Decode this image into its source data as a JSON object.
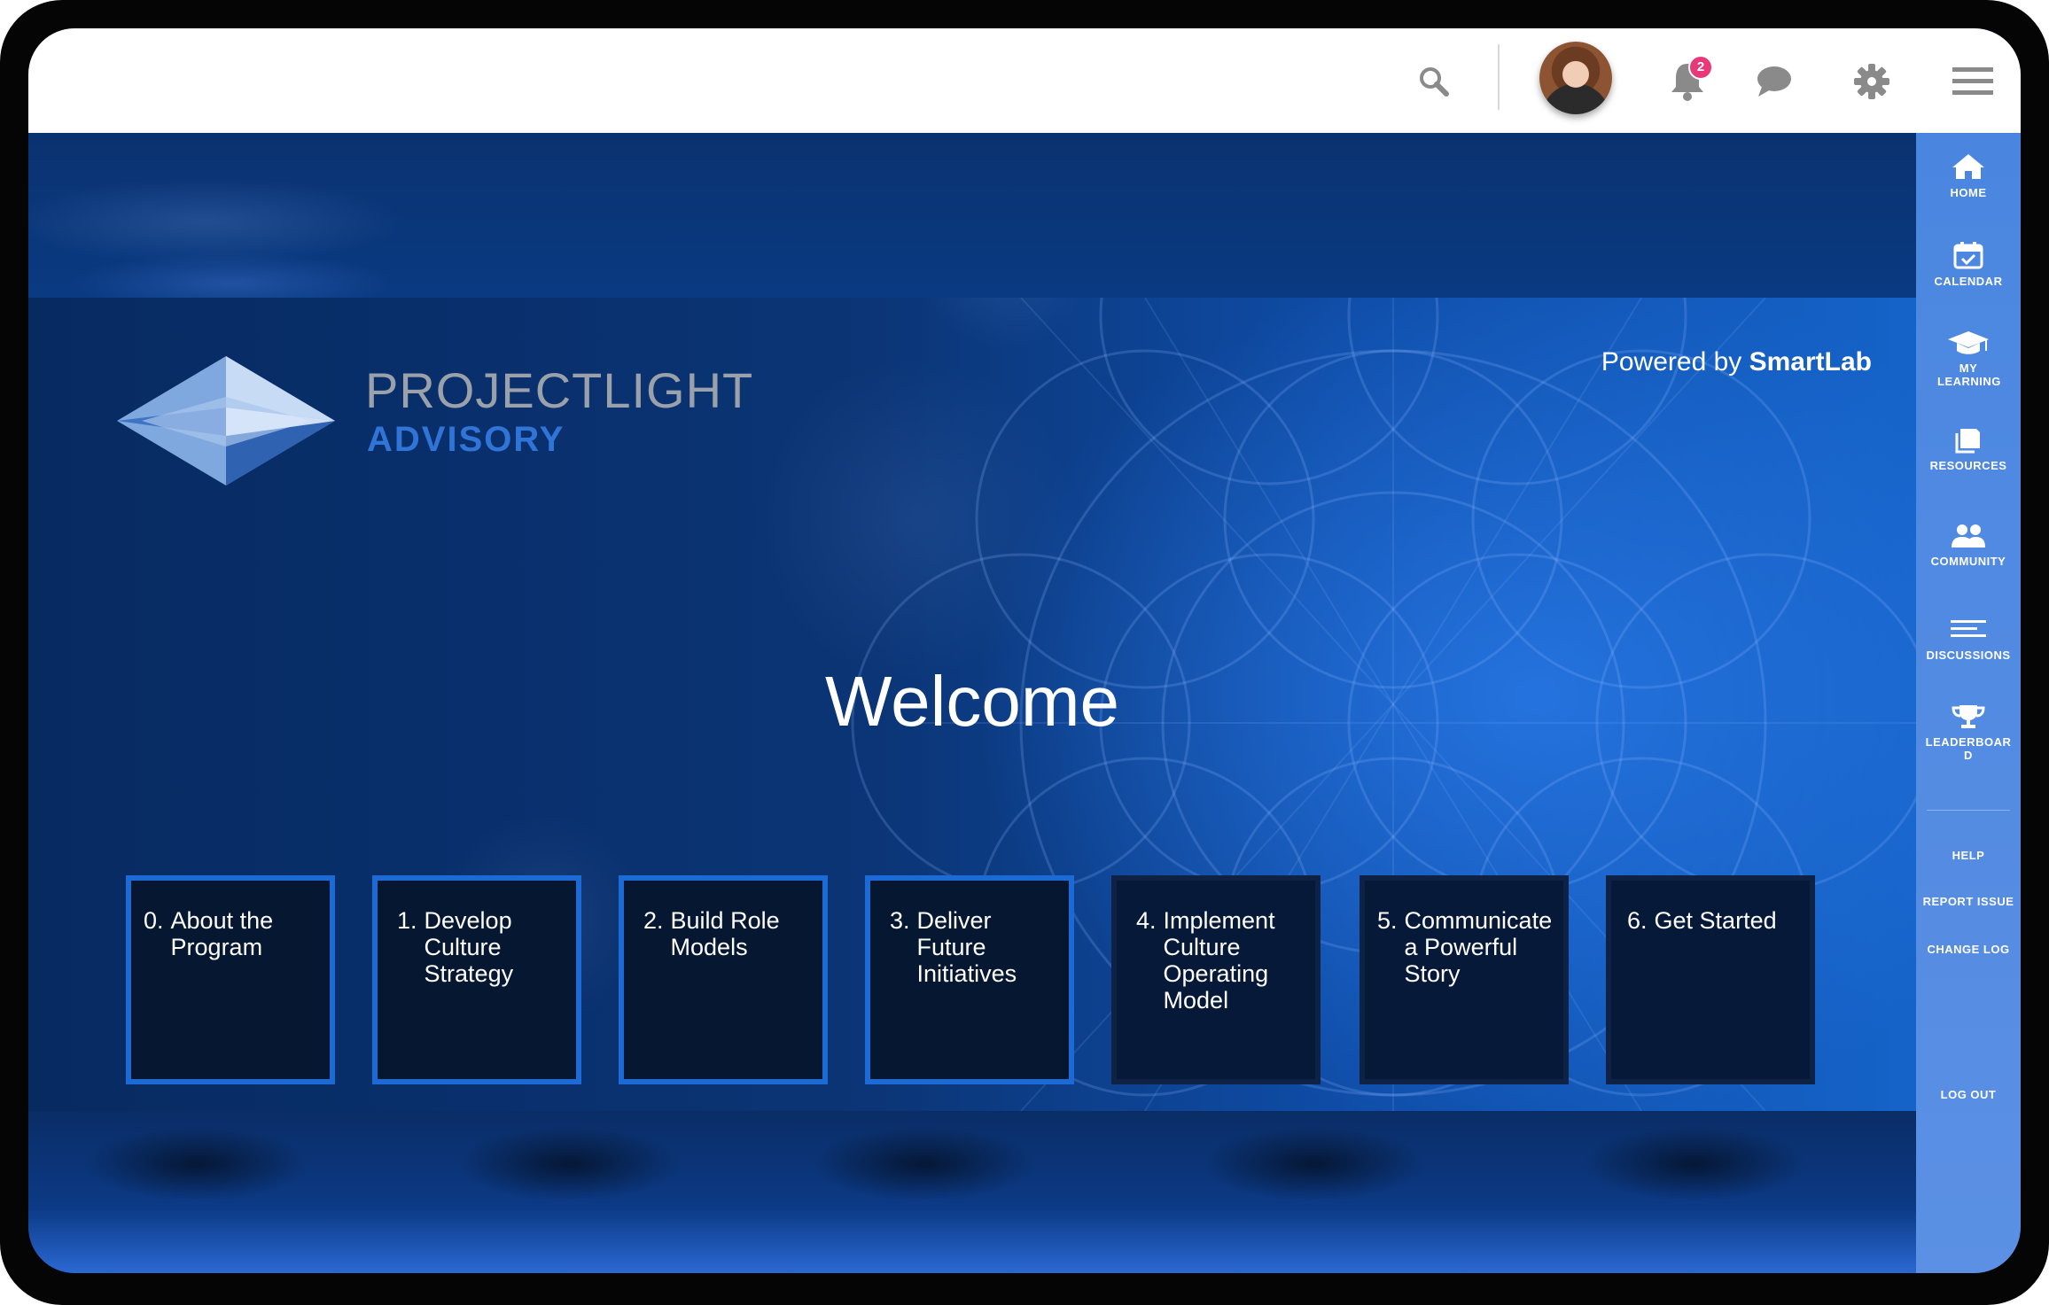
{
  "brand": {
    "line1": "PROJECTLIGHT",
    "line2": "ADVISORY",
    "powered_prefix": "Powered by",
    "powered_brand": "SmartLab"
  },
  "header": {
    "notification_count": "2",
    "icons": [
      "search-icon",
      "avatar",
      "bell-icon",
      "chat-icon",
      "gear-icon",
      "hamburger-menu-icon"
    ]
  },
  "hero": {
    "welcome": "Welcome"
  },
  "tiles": [
    {
      "num": "0.",
      "label": "About the Program"
    },
    {
      "num": "1.",
      "label": "Develop Culture Strategy"
    },
    {
      "num": "2.",
      "label": "Build Role Models"
    },
    {
      "num": "3.",
      "label": "Deliver Future Initiatives"
    },
    {
      "num": "4.",
      "label": "Implement Culture Operating Model"
    },
    {
      "num": "5.",
      "label": "Communicate a Powerful Story"
    },
    {
      "num": "6.",
      "label": "Get Started"
    }
  ],
  "sidebar": {
    "items": [
      {
        "label": "HOME",
        "icon": "home-icon"
      },
      {
        "label": "CALENDAR",
        "icon": "calendar-icon"
      },
      {
        "label": "MY LEARNING",
        "icon": "graduation-cap-icon"
      },
      {
        "label": "RESOURCES",
        "icon": "documents-icon"
      },
      {
        "label": "COMMUNITY",
        "icon": "people-icon"
      },
      {
        "label": "DISCUSSIONS",
        "icon": "lines-icon"
      },
      {
        "label": "LEADERBOARD",
        "icon": "trophy-icon"
      }
    ],
    "links": [
      "HELP",
      "REPORT ISSUE",
      "CHANGE LOG"
    ],
    "logout": "LOG OUT"
  },
  "colors": {
    "accent": "#1c6ad6",
    "sidebar": "#4a86e0",
    "badge": "#e8387a",
    "tile_bg": "#061731"
  }
}
